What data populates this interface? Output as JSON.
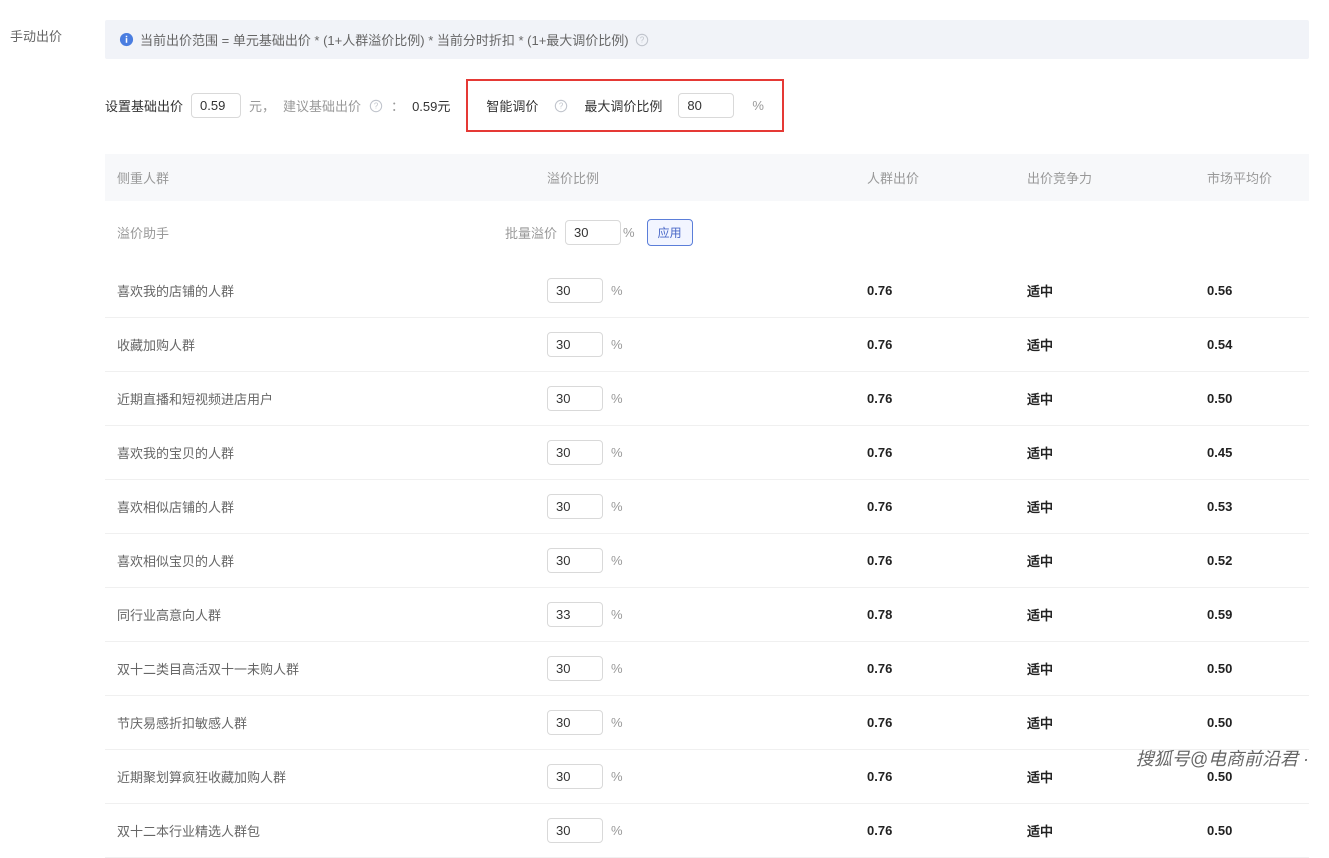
{
  "left_label": "手动出价",
  "formula": {
    "text": "当前出价范围 = 单元基础出价 * (1+人群溢价比例) * 当前分时折扣 * (1+最大调价比例)"
  },
  "base_bid": {
    "label": "设置基础出价",
    "value": "0.59",
    "unit_prefix": "元，",
    "suggest_label": "建议基础出价",
    "suggest_colon": "：",
    "suggest_value": "0.59元"
  },
  "smart": {
    "label": "智能调价",
    "max_label": "最大调价比例",
    "value": "80",
    "unit": "%"
  },
  "thead": {
    "name": "侧重人群",
    "premium": "溢价比例",
    "bid": "人群出价",
    "comp": "出价竞争力",
    "avg": "市场平均价"
  },
  "helper": {
    "label": "溢价助手",
    "batch_label": "批量溢价",
    "value": "30",
    "unit": "%",
    "apply": "应用"
  },
  "rows": [
    {
      "name": "喜欢我的店铺的人群",
      "premium": "30",
      "bid": "0.76",
      "comp": "适中",
      "avg": "0.56"
    },
    {
      "name": "收藏加购人群",
      "premium": "30",
      "bid": "0.76",
      "comp": "适中",
      "avg": "0.54"
    },
    {
      "name": "近期直播和短视频进店用户",
      "premium": "30",
      "bid": "0.76",
      "comp": "适中",
      "avg": "0.50"
    },
    {
      "name": "喜欢我的宝贝的人群",
      "premium": "30",
      "bid": "0.76",
      "comp": "适中",
      "avg": "0.45"
    },
    {
      "name": "喜欢相似店铺的人群",
      "premium": "30",
      "bid": "0.76",
      "comp": "适中",
      "avg": "0.53"
    },
    {
      "name": "喜欢相似宝贝的人群",
      "premium": "30",
      "bid": "0.76",
      "comp": "适中",
      "avg": "0.52"
    },
    {
      "name": "同行业高意向人群",
      "premium": "33",
      "bid": "0.78",
      "comp": "适中",
      "avg": "0.59"
    },
    {
      "name": "双十二类目高活双十一未购人群",
      "premium": "30",
      "bid": "0.76",
      "comp": "适中",
      "avg": "0.50"
    },
    {
      "name": "节庆易感折扣敏感人群",
      "premium": "30",
      "bid": "0.76",
      "comp": "适中",
      "avg": "0.50"
    },
    {
      "name": "近期聚划算疯狂收藏加购人群",
      "premium": "30",
      "bid": "0.76",
      "comp": "适中",
      "avg": "0.50"
    },
    {
      "name": "双十二本行业精选人群包",
      "premium": "30",
      "bid": "0.76",
      "comp": "适中",
      "avg": "0.50"
    }
  ],
  "watermark": "搜狐号@电商前沿君 ·"
}
